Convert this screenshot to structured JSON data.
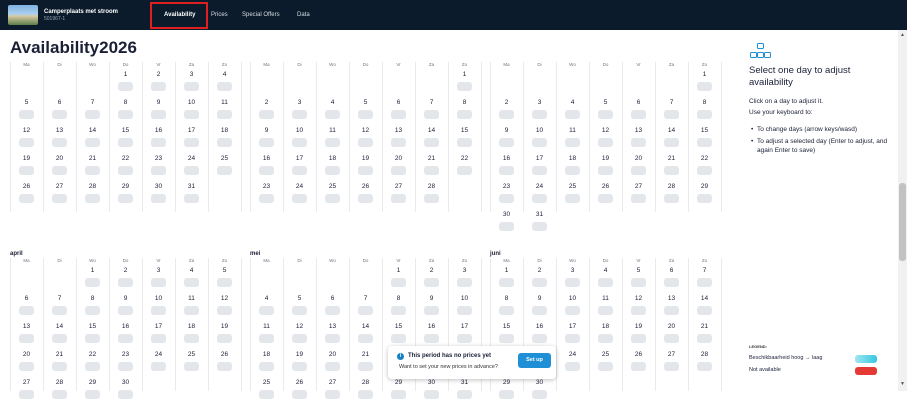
{
  "topbar": {
    "listing_title": "Camperplaats met stroom",
    "listing_id": "501967-1",
    "tabs": [
      {
        "label": "Availability",
        "active": true
      },
      {
        "label": "Prices",
        "active": false
      },
      {
        "label": "Special Offers",
        "active": false
      },
      {
        "label": "Data",
        "active": false
      }
    ]
  },
  "page": {
    "title": "Availability2026"
  },
  "weekdays": [
    "Ma",
    "Di",
    "Wo",
    "Do",
    "Vr",
    "Za",
    "Zo"
  ],
  "calendars": [
    {
      "name": "",
      "weeks": [
        [
          null,
          null,
          null,
          1,
          2,
          3,
          4
        ],
        [
          5,
          6,
          7,
          8,
          9,
          10,
          11
        ],
        [
          12,
          13,
          14,
          15,
          16,
          17,
          18
        ],
        [
          19,
          20,
          21,
          22,
          23,
          24,
          25
        ],
        [
          26,
          27,
          28,
          29,
          30,
          31,
          null
        ]
      ]
    },
    {
      "name": "",
      "weeks": [
        [
          null,
          null,
          null,
          null,
          null,
          null,
          1
        ],
        [
          2,
          3,
          4,
          5,
          6,
          7,
          8
        ],
        [
          9,
          10,
          11,
          12,
          13,
          14,
          15
        ],
        [
          16,
          17,
          18,
          19,
          20,
          21,
          22
        ],
        [
          23,
          24,
          25,
          26,
          27,
          28,
          null
        ]
      ]
    },
    {
      "name": "",
      "weeks": [
        [
          null,
          null,
          null,
          null,
          null,
          null,
          1
        ],
        [
          2,
          3,
          4,
          5,
          6,
          7,
          8
        ],
        [
          9,
          10,
          11,
          12,
          13,
          14,
          15
        ],
        [
          16,
          17,
          18,
          19,
          20,
          21,
          22
        ],
        [
          23,
          24,
          25,
          26,
          27,
          28,
          29
        ],
        [
          30,
          31,
          null,
          null,
          null,
          null,
          null
        ]
      ]
    },
    {
      "name": "april",
      "weeks": [
        [
          null,
          null,
          1,
          2,
          3,
          4,
          5
        ],
        [
          6,
          7,
          8,
          9,
          10,
          11,
          12
        ],
        [
          13,
          14,
          15,
          16,
          17,
          18,
          19
        ],
        [
          20,
          21,
          22,
          23,
          24,
          25,
          26
        ],
        [
          27,
          28,
          29,
          30,
          null,
          null,
          null
        ]
      ]
    },
    {
      "name": "mei",
      "weeks": [
        [
          null,
          null,
          null,
          null,
          1,
          2,
          3
        ],
        [
          4,
          5,
          6,
          7,
          8,
          9,
          10
        ],
        [
          11,
          12,
          13,
          14,
          15,
          16,
          17
        ],
        [
          18,
          19,
          20,
          21,
          22,
          23,
          24
        ],
        [
          25,
          26,
          27,
          28,
          29,
          30,
          31
        ]
      ]
    },
    {
      "name": "juni",
      "weeks": [
        [
          1,
          2,
          3,
          4,
          5,
          6,
          7
        ],
        [
          8,
          9,
          10,
          11,
          12,
          13,
          14
        ],
        [
          15,
          16,
          17,
          18,
          19,
          20,
          21
        ],
        [
          22,
          23,
          24,
          25,
          26,
          27,
          28
        ],
        [
          29,
          30,
          null,
          null,
          null,
          null,
          null
        ]
      ]
    }
  ],
  "help": {
    "icon": "calendar-grid-icon",
    "title": "Select one day to adjust availability",
    "p1": "Click on a day to adjust it.",
    "p2": "Use your keyboard to:",
    "li1": "To change days (arrow keys/wasd)",
    "li2": "To adjust a selected day (Enter to adjust, and again Enter to save)"
  },
  "legend": {
    "title": "LEGEND:",
    "items": [
      {
        "label": "Beschikbaarheid hoog → laag",
        "color": "#37c6e0"
      },
      {
        "label": "Not available",
        "color": "#e53935"
      }
    ]
  },
  "toast": {
    "title": "This period has no prices yet",
    "text": "Want to set your new prices in advance?",
    "button": "Set up"
  },
  "colors": {
    "topbar": "#0b1b2b",
    "accent": "#1f8fd6",
    "pill": "#e3e6ea"
  }
}
